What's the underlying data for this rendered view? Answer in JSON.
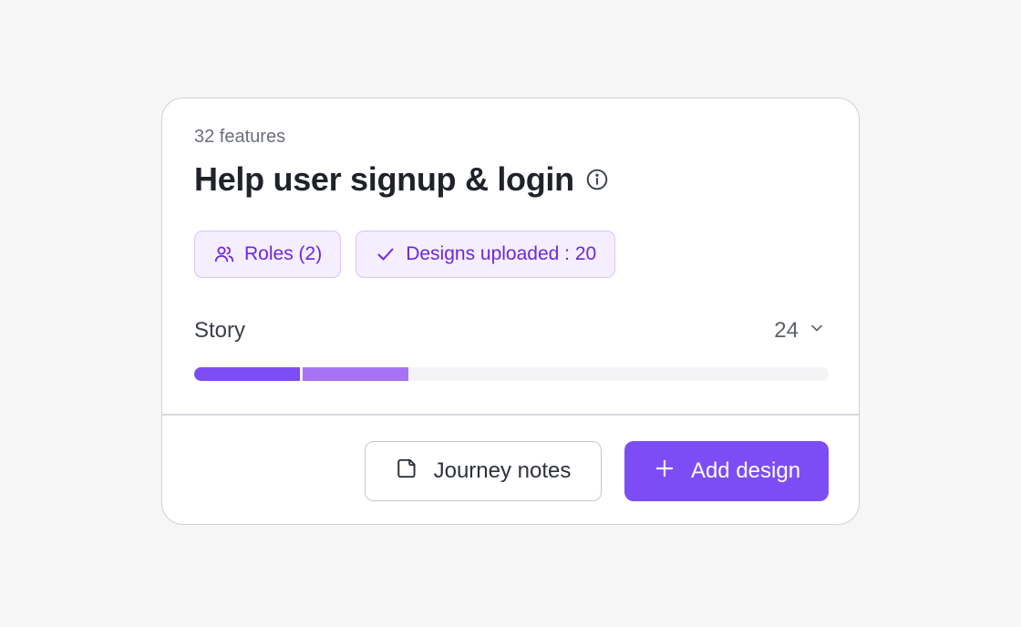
{
  "card": {
    "feature_count": "32 features",
    "title": "Help user signup & login",
    "info_icon": "info-circle-icon"
  },
  "chips": [
    {
      "icon": "users-icon",
      "label": "Roles (2)"
    },
    {
      "icon": "check-icon",
      "label": "Designs uploaded : 20"
    }
  ],
  "story": {
    "label": "Story",
    "count": "24",
    "dropdown_icon": "chevron-down-icon",
    "progress_segments": [
      {
        "fraction": 0.167,
        "color": "#7c4df5"
      },
      {
        "fraction": 0.167,
        "color": "#a673f4"
      }
    ]
  },
  "actions": {
    "journey_notes": {
      "icon": "note-icon",
      "label": "Journey notes"
    },
    "add_design": {
      "icon": "plus-icon",
      "label": "Add design"
    }
  },
  "colors": {
    "accent": "#7c4df5",
    "chip_bg": "#f4eefe",
    "chip_text": "#6d28d9"
  }
}
